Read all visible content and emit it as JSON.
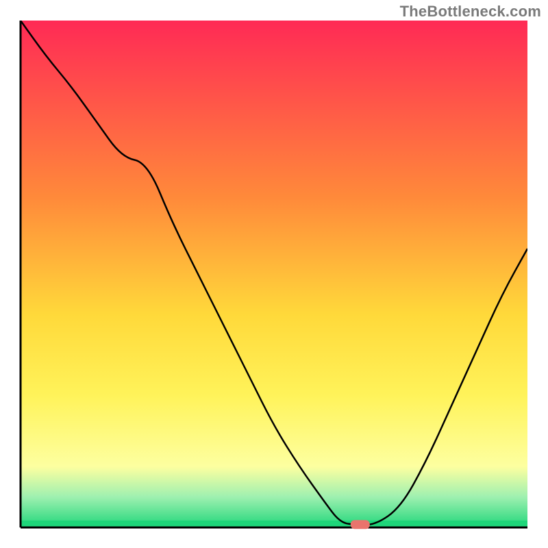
{
  "watermark": "TheBottleneck.com",
  "colors": {
    "curve": "#000000",
    "axis": "#000000",
    "marker": "#e9746d",
    "gradient_top": "#ff2a55",
    "gradient_mid1": "#ff8a3a",
    "gradient_mid2": "#ffd93a",
    "gradient_mid3": "#fff35a",
    "gradient_mid4": "#fdffa0",
    "gradient_bottom_band": "#9ef0b0",
    "gradient_green": "#1fd67a"
  },
  "chart_data": {
    "type": "line",
    "title": "",
    "xlabel": "",
    "ylabel": "",
    "xlim": [
      0,
      100
    ],
    "ylim": [
      0,
      100
    ],
    "grid": false,
    "legend": false,
    "x": [
      0,
      5,
      10,
      15,
      20,
      25,
      30,
      35,
      40,
      45,
      50,
      55,
      60,
      63,
      66,
      70,
      75,
      80,
      85,
      90,
      95,
      100
    ],
    "values": [
      100,
      93,
      87,
      80,
      73,
      72,
      60,
      50,
      40,
      30,
      20,
      12,
      5,
      1,
      0.5,
      0.5,
      4,
      13,
      24,
      35,
      46,
      55
    ],
    "marker": {
      "x": 67,
      "y": 0.5
    },
    "notes": "Values are read off the curve in an axis-less bottleneck gradient chart. Y is percent of chart height from bottom (0) to top (100). X is percent of chart width from left (0) to right (100). The curve descends from top-left, flattens near x≈63–70, then rises to the right. A single rounded-rectangle marker sits on the flat minimum around x≈67."
  }
}
